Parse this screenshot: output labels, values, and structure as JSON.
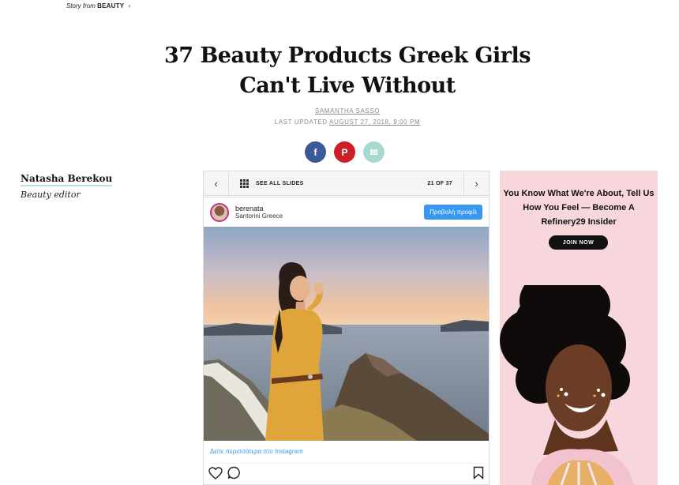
{
  "story": {
    "prefix": "Story from",
    "section": "BEAUTY",
    "chevron": "›"
  },
  "article": {
    "title": "37 Beauty Products Greek Girls Can't Live Without",
    "author": "SAMANTHA SASSO",
    "updated_label": "LAST UPDATED",
    "updated_date": "AUGUST 27, 2018, 9:00 PM"
  },
  "share": {
    "facebook": "f",
    "pinterest": "P",
    "email": "✉"
  },
  "contributor": {
    "name": "Natasha Berekou",
    "role": "Beauty editor"
  },
  "slides": {
    "see_all": "SEE ALL SLIDES",
    "counter": "21 OF 37",
    "prev": "‹",
    "next": "›"
  },
  "instagram": {
    "username": "berenata",
    "location": "Santorini Greece",
    "follow_button": "Προβολή προφίλ",
    "more_link": "Δείτε περισσότερα στο Instagram"
  },
  "ad": {
    "headline": "You Know What We're About, Tell Us How You Feel — Become A Refinery29 Insider",
    "cta": "JOIN NOW"
  },
  "colors": {
    "facebook": "#3b5998",
    "pinterest": "#cb2027",
    "email": "#a8d8d2",
    "instagram_blue": "#3897f0",
    "ad_bg": "#f7d6dc"
  }
}
